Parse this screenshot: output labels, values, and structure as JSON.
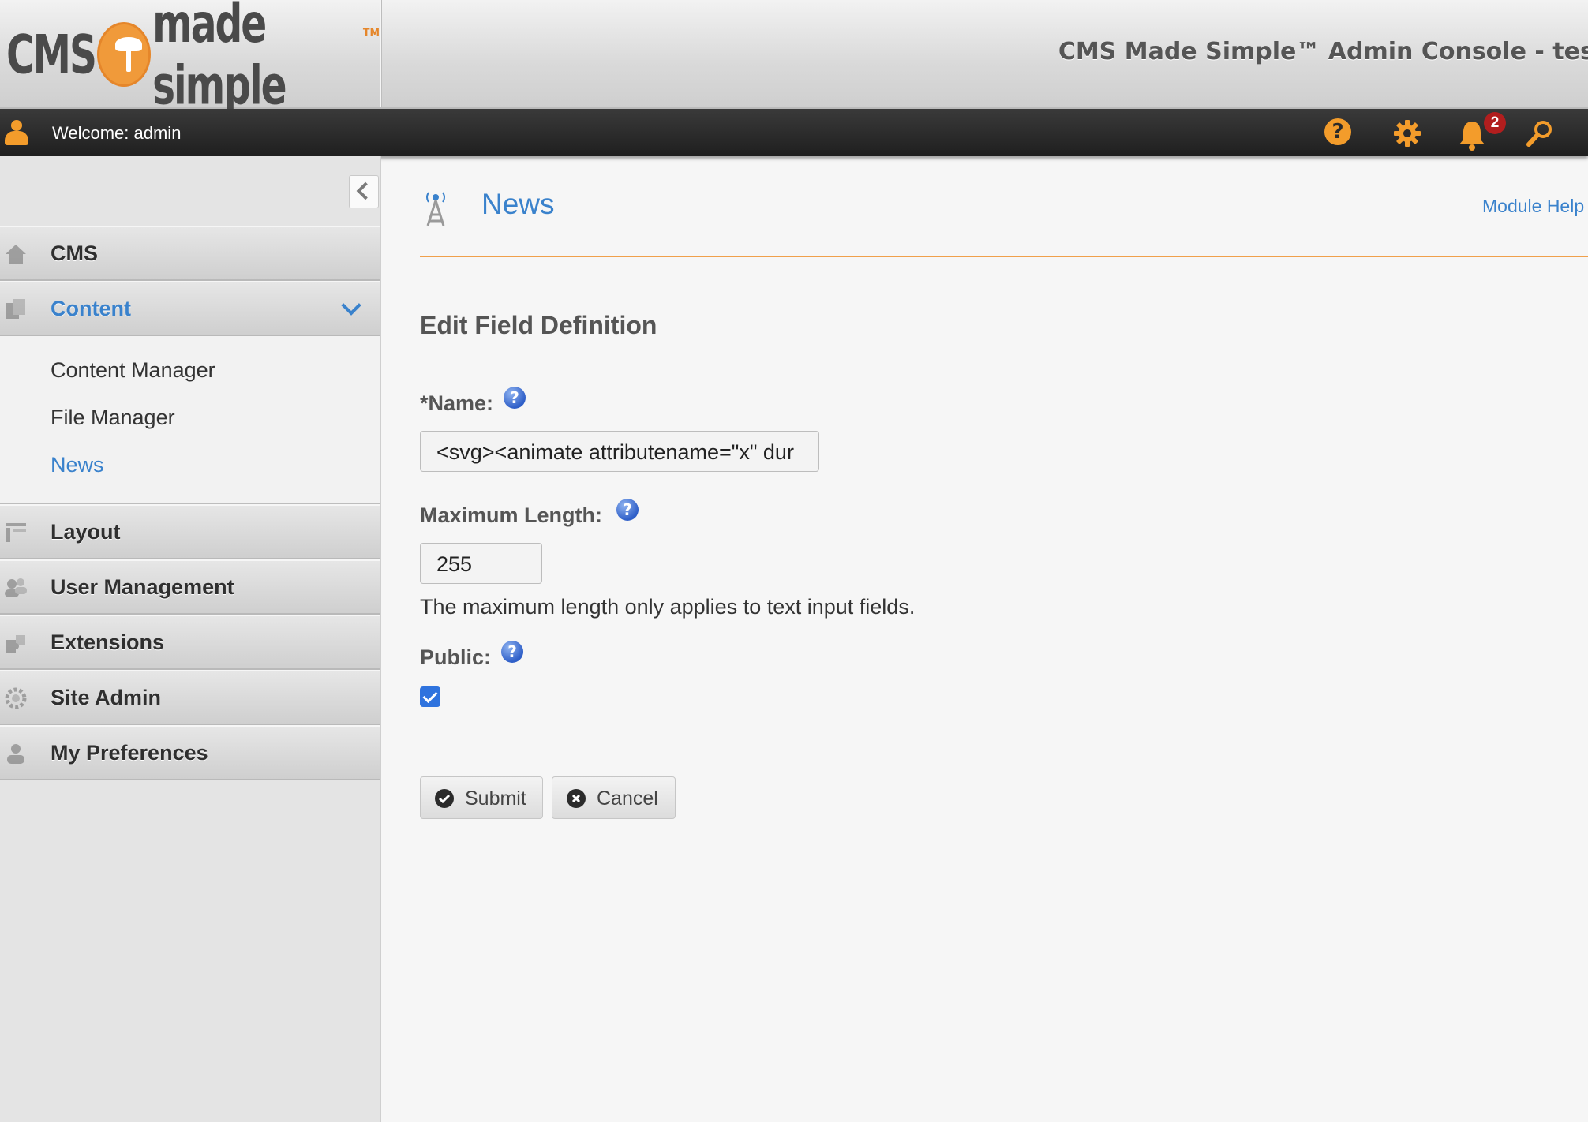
{
  "header": {
    "logo_text_left": "CMS",
    "logo_text_right": "made simple",
    "logo_tm": "TM",
    "console_title": "CMS Made Simple™ Admin Console - tests"
  },
  "userbar": {
    "welcome": "Welcome: admin",
    "notification_count": "2",
    "icons": [
      "help-icon",
      "gear-icon",
      "bell-icon",
      "search-icon"
    ],
    "accent_color": "#f39c2b"
  },
  "sidebar": {
    "sections": [
      {
        "label": "CMS",
        "icon": "home-icon"
      },
      {
        "label": "Content",
        "icon": "content-icon",
        "active": true
      },
      {
        "label": "Layout",
        "icon": "layout-icon"
      },
      {
        "label": "User Management",
        "icon": "users-icon"
      },
      {
        "label": "Extensions",
        "icon": "puzzle-icon"
      },
      {
        "label": "Site Admin",
        "icon": "gear-icon"
      },
      {
        "label": "My Preferences",
        "icon": "user-icon"
      }
    ],
    "content_items": [
      {
        "label": "Content Manager"
      },
      {
        "label": "File Manager"
      },
      {
        "label": "News",
        "current": true
      }
    ]
  },
  "main": {
    "page_title": "News",
    "module_help": "Module Help",
    "section_heading": "Edit Field Definition",
    "name_label": "*Name:",
    "name_value": "<svg><animate attributename=\"x\" dur",
    "maxlen_label": "Maximum Length:",
    "maxlen_value": "255",
    "maxlen_hint": "The maximum length only applies to text input fields.",
    "public_label": "Public:",
    "public_checked": true,
    "help_mark": "?",
    "submit_label": "Submit",
    "cancel_label": "Cancel",
    "link_color": "#3a82cc",
    "rule_color": "#f0a04b"
  }
}
